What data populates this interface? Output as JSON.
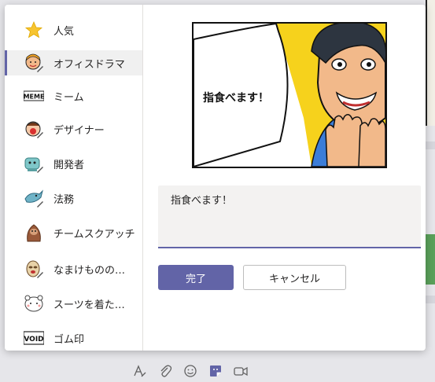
{
  "sidebar": {
    "items": [
      {
        "label": "人気",
        "icon": "star-icon"
      },
      {
        "label": "オフィスドラマ",
        "icon": "office-drama-icon"
      },
      {
        "label": "ミーム",
        "icon": "meme-icon"
      },
      {
        "label": "デザイナー",
        "icon": "designer-icon"
      },
      {
        "label": "開発者",
        "icon": "developer-icon"
      },
      {
        "label": "法務",
        "icon": "legal-icon"
      },
      {
        "label": "チームスクアッチ",
        "icon": "team-squatch-icon"
      },
      {
        "label": "なまけものの…",
        "icon": "sloth-icon"
      },
      {
        "label": "スーツを着た…",
        "icon": "suit-icon"
      },
      {
        "label": "ゴム印",
        "icon": "rubber-stamp-icon"
      }
    ],
    "meme_icon_text": "MEME",
    "stamp_icon_text": "VOID",
    "selected_index": 1
  },
  "preview": {
    "caption": "指食べます！"
  },
  "editor": {
    "value": "指食べます！"
  },
  "buttons": {
    "done": "完了",
    "cancel": "キャンセル"
  },
  "toolbar": {
    "icons": [
      "format-icon",
      "attach-icon",
      "emoji-icon",
      "sticker-icon",
      "meet-now-icon"
    ]
  },
  "colors": {
    "accent": "#6264a7",
    "comic_yellow": "#f6d21c",
    "comic_blue": "#3b7dd8"
  }
}
